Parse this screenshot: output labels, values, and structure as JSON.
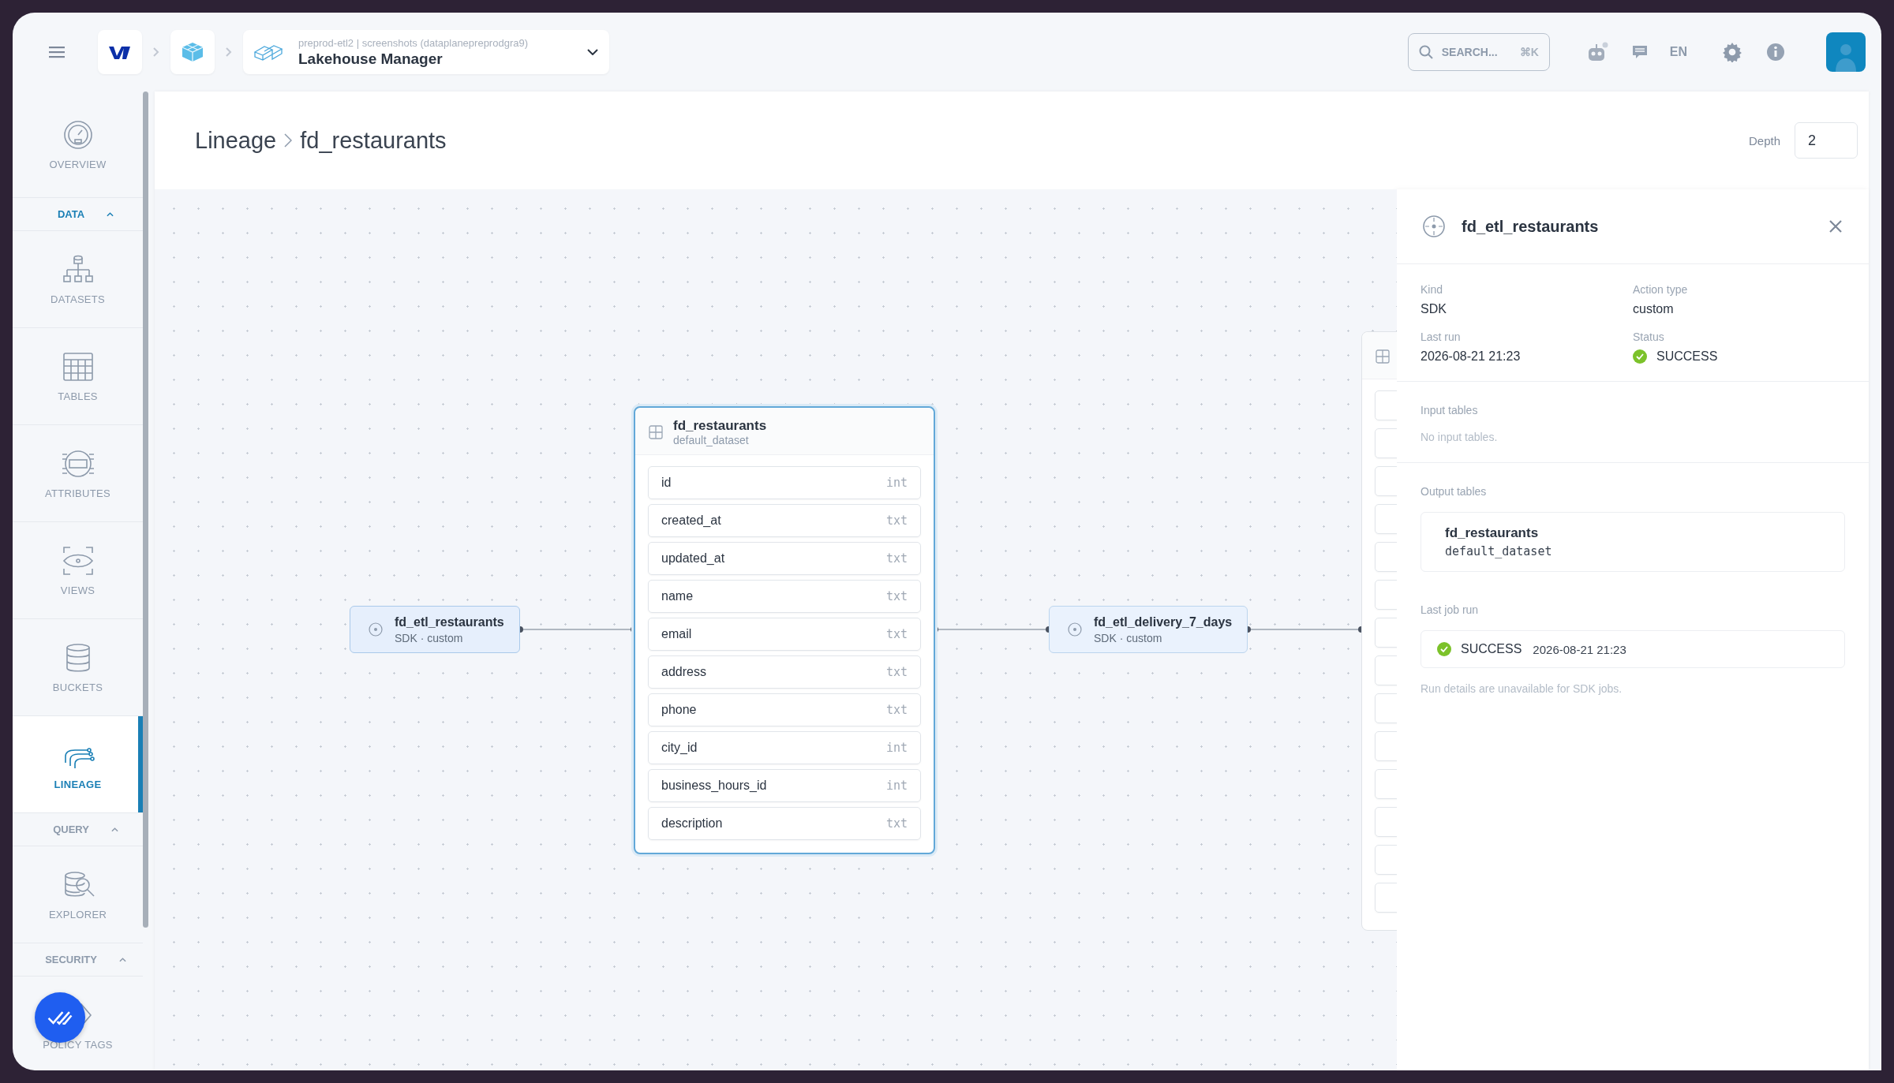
{
  "top_bar": {
    "breadcrumb": {
      "context": "preprod-etl2 | screenshots (dataplanepreprodgra9)",
      "title": "Lakehouse Manager"
    },
    "search": {
      "placeholder": "SEARCH...",
      "shortcut": "⌘K"
    },
    "language": "EN"
  },
  "sidebar": {
    "items": [
      {
        "kind": "item",
        "label": "OVERVIEW",
        "selected": false
      },
      {
        "kind": "section",
        "label": "DATA",
        "expanded": true
      },
      {
        "kind": "item",
        "label": "DATASETS",
        "selected": false
      },
      {
        "kind": "item",
        "label": "TABLES",
        "selected": false
      },
      {
        "kind": "item",
        "label": "ATTRIBUTES",
        "selected": false
      },
      {
        "kind": "item",
        "label": "VIEWS",
        "selected": false
      },
      {
        "kind": "item",
        "label": "BUCKETS",
        "selected": false
      },
      {
        "kind": "item",
        "label": "LINEAGE",
        "selected": true
      },
      {
        "kind": "section",
        "label": "QUERY",
        "expanded": true
      },
      {
        "kind": "item",
        "label": "EXPLORER",
        "selected": false
      },
      {
        "kind": "section",
        "label": "SECURITY",
        "expanded": true
      },
      {
        "kind": "item",
        "label": "POLICY TAGS",
        "selected": false
      }
    ]
  },
  "page_header": {
    "breadcrumb": [
      "Lineage",
      "fd_restaurants"
    ],
    "depth": {
      "label": "Depth",
      "value": "2"
    }
  },
  "canvas": {
    "nodes": [
      {
        "kind": "job",
        "name": "fd_etl_restaurants",
        "meta": "SDK · custom",
        "selected": true
      },
      {
        "kind": "table",
        "name": "fd_restaurants",
        "dataset": "default_dataset",
        "columns": [
          {
            "name": "id",
            "type": "int"
          },
          {
            "name": "created_at",
            "type": "txt"
          },
          {
            "name": "updated_at",
            "type": "txt"
          },
          {
            "name": "name",
            "type": "txt"
          },
          {
            "name": "email",
            "type": "txt"
          },
          {
            "name": "address",
            "type": "txt"
          },
          {
            "name": "phone",
            "type": "txt"
          },
          {
            "name": "city_id",
            "type": "int"
          },
          {
            "name": "business_hours_id",
            "type": "int"
          },
          {
            "name": "description",
            "type": "txt"
          }
        ]
      },
      {
        "kind": "job",
        "name": "fd_etl_delivery_7_days",
        "meta": "SDK · custom",
        "selected": false
      }
    ]
  },
  "details_panel": {
    "title": "fd_etl_restaurants",
    "fields": [
      {
        "kind": "text",
        "label": "Kind",
        "value": "SDK"
      },
      {
        "kind": "text",
        "label": "Action type",
        "value": "custom"
      },
      {
        "kind": "text",
        "label": "Last run",
        "value": "2026-08-21 21:23"
      },
      {
        "kind": "status",
        "label": "Status",
        "value": "SUCCESS",
        "succeeded": true
      }
    ],
    "input_tables": {
      "label": "Input tables",
      "empty": "No input tables."
    },
    "output_tables": {
      "label": "Output tables",
      "tables": [
        {
          "name": "fd_restaurants",
          "dataset": "default_dataset"
        }
      ]
    },
    "last_job_run": {
      "label": "Last job run",
      "succeeded": true,
      "status_text": "SUCCESS",
      "time": "2026-08-21 21:23",
      "note": "Run details are unavailable for SDK jobs."
    }
  }
}
